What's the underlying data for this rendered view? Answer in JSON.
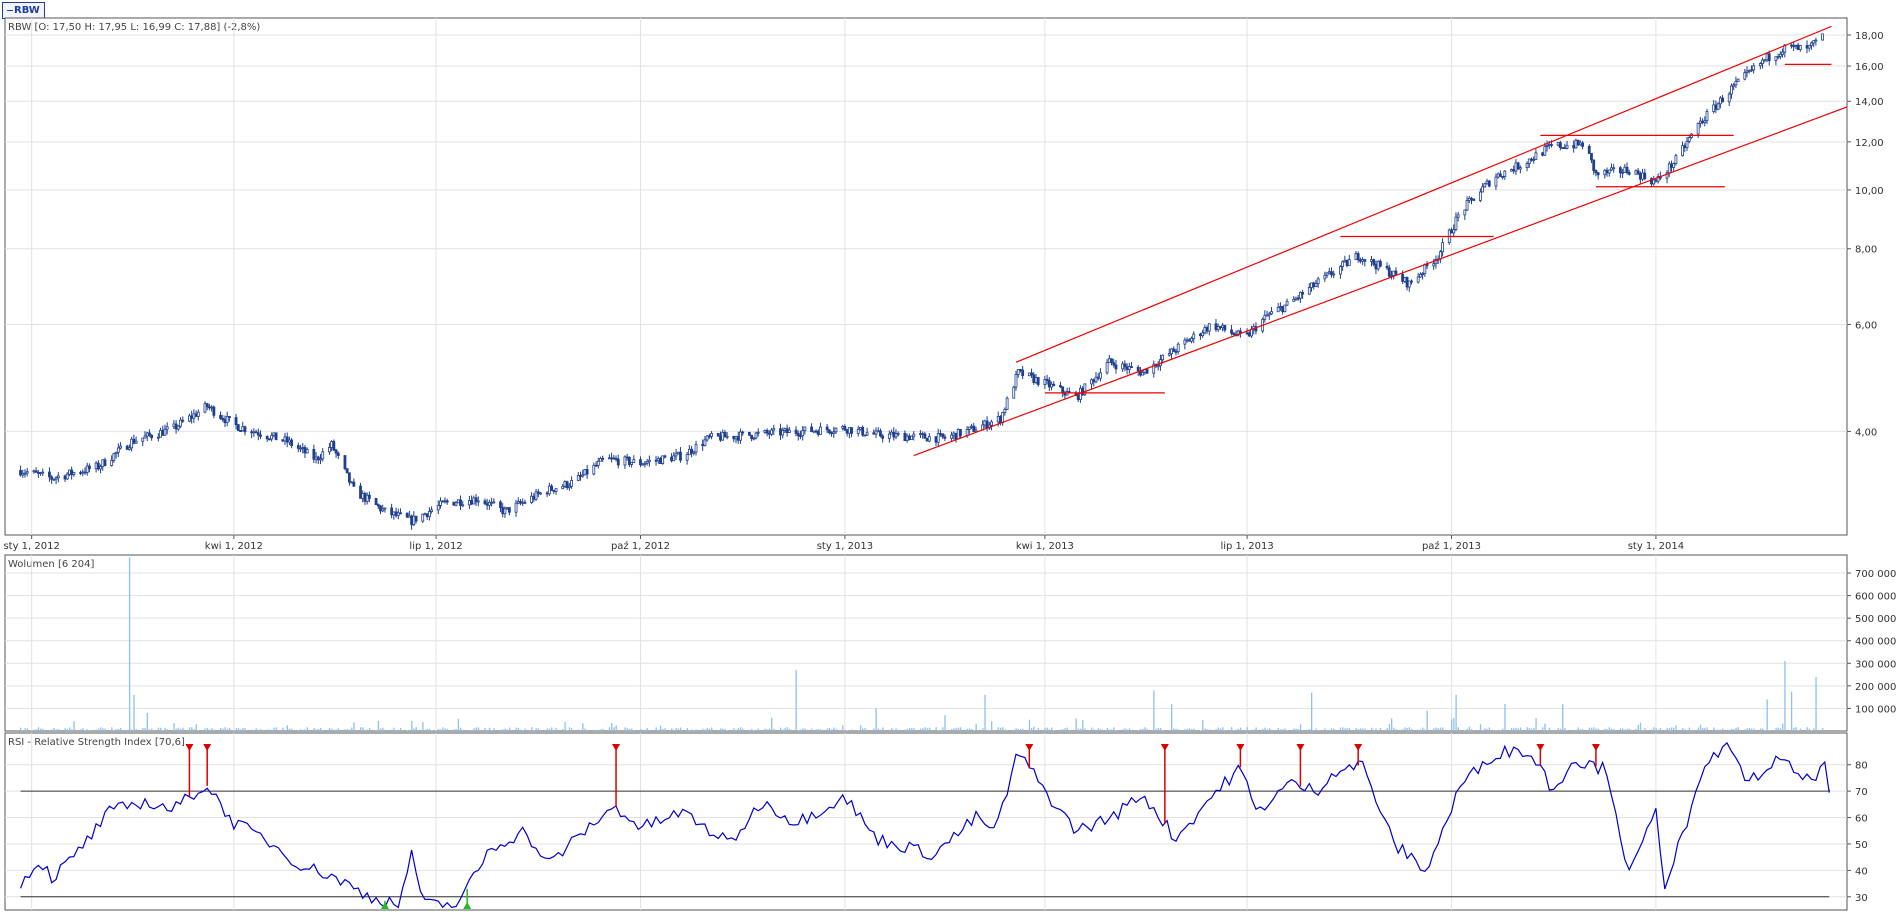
{
  "tab": {
    "label": "RBW"
  },
  "chart_data": [
    {
      "type": "candlestick",
      "title": "RBW [O: 17,50  H: 17,95  L: 16,99  C: 17,88] (-2,8%)",
      "y_scale": "log",
      "ylim": [
        2.7,
        19.2
      ],
      "yticks": [
        4,
        6,
        8,
        10,
        12,
        14,
        16,
        18
      ],
      "ytick_labels": [
        "4,00",
        "6,00",
        "8,00",
        "10,00",
        "12,00",
        "14,00",
        "16,00",
        "18,00"
      ],
      "xlim": [
        "2011-12-20",
        "2014-03-28"
      ],
      "xticks": [
        {
          "date": "2012-01-01",
          "label": "sty 1, 2012"
        },
        {
          "date": "2012-04-01",
          "label": "kwi 1, 2012"
        },
        {
          "date": "2012-07-01",
          "label": "lip 1, 2012"
        },
        {
          "date": "2012-10-01",
          "label": "paź 1, 2012"
        },
        {
          "date": "2013-01-01",
          "label": "sty 1, 2013"
        },
        {
          "date": "2013-04-01",
          "label": "kwi 1, 2013"
        },
        {
          "date": "2013-07-01",
          "label": "lip 1, 2013"
        },
        {
          "date": "2013-10-01",
          "label": "paź 1, 2013"
        },
        {
          "date": "2014-01-01",
          "label": "sty 1, 2014"
        }
      ],
      "close_path": [
        [
          "2011-12-27",
          3.45
        ],
        [
          "2012-01-10",
          3.35
        ],
        [
          "2012-01-31",
          3.5
        ],
        [
          "2012-02-15",
          3.85
        ],
        [
          "2012-03-05",
          4.05
        ],
        [
          "2012-03-20",
          4.4
        ],
        [
          "2012-04-01",
          4.1
        ],
        [
          "2012-04-25",
          3.85
        ],
        [
          "2012-05-08",
          3.6
        ],
        [
          "2012-05-15",
          3.8
        ],
        [
          "2012-05-25",
          3.2
        ],
        [
          "2012-06-08",
          2.95
        ],
        [
          "2012-06-20",
          2.85
        ],
        [
          "2012-07-05",
          3.05
        ],
        [
          "2012-07-20",
          3.1
        ],
        [
          "2012-08-01",
          2.95
        ],
        [
          "2012-08-20",
          3.2
        ],
        [
          "2012-09-01",
          3.3
        ],
        [
          "2012-09-15",
          3.6
        ],
        [
          "2012-10-01",
          3.55
        ],
        [
          "2012-10-20",
          3.65
        ],
        [
          "2012-11-01",
          3.9
        ],
        [
          "2012-11-20",
          3.95
        ],
        [
          "2012-12-10",
          4.0
        ],
        [
          "2013-01-01",
          4.05
        ],
        [
          "2013-01-15",
          3.95
        ],
        [
          "2013-02-15",
          3.9
        ],
        [
          "2013-03-01",
          4.05
        ],
        [
          "2013-03-12",
          4.2
        ],
        [
          "2013-03-20",
          5.0
        ],
        [
          "2013-04-01",
          4.8
        ],
        [
          "2013-04-15",
          4.55
        ],
        [
          "2013-04-30",
          5.2
        ],
        [
          "2013-05-15",
          5.0
        ],
        [
          "2013-05-31",
          5.5
        ],
        [
          "2013-06-15",
          6.0
        ],
        [
          "2013-06-30",
          5.7
        ],
        [
          "2013-07-10",
          6.2
        ],
        [
          "2013-07-20",
          6.5
        ],
        [
          "2013-08-01",
          7.0
        ],
        [
          "2013-08-20",
          7.8
        ],
        [
          "2013-09-01",
          7.4
        ],
        [
          "2013-09-12",
          7.0
        ],
        [
          "2013-09-25",
          7.8
        ],
        [
          "2013-10-05",
          9.2
        ],
        [
          "2013-10-20",
          10.5
        ],
        [
          "2013-11-01",
          11.0
        ],
        [
          "2013-11-15",
          11.8
        ],
        [
          "2013-11-30",
          11.9
        ],
        [
          "2013-12-05",
          10.6
        ],
        [
          "2013-12-20",
          10.8
        ],
        [
          "2014-01-01",
          10.3
        ],
        [
          "2014-01-10",
          11.2
        ],
        [
          "2014-01-20",
          12.8
        ],
        [
          "2014-02-05",
          14.8
        ],
        [
          "2014-02-20",
          16.5
        ],
        [
          "2014-03-01",
          17.2
        ],
        [
          "2014-03-10",
          17.0
        ],
        [
          "2014-03-17",
          17.88
        ]
      ],
      "trendlines": [
        {
          "role": "channel-upper",
          "from": [
            "2013-03-19",
            5.2
          ],
          "to": [
            "2014-03-21",
            18.6
          ]
        },
        {
          "role": "channel-lower",
          "from": [
            "2013-02-01",
            3.65
          ],
          "to": [
            "2014-03-28",
            13.7
          ]
        },
        {
          "role": "support",
          "from": [
            "2013-04-01",
            4.63
          ],
          "to": [
            "2013-05-25",
            4.63
          ]
        },
        {
          "role": "resistance",
          "from": [
            "2013-08-12",
            8.38
          ],
          "to": [
            "2013-10-20",
            8.38
          ]
        },
        {
          "role": "resistance",
          "from": [
            "2013-11-10",
            12.3
          ],
          "to": [
            "2014-02-05",
            12.3
          ]
        },
        {
          "role": "support",
          "from": [
            "2013-12-05",
            10.12
          ],
          "to": [
            "2014-02-01",
            10.12
          ]
        },
        {
          "role": "support",
          "from": [
            "2014-02-28",
            16.1
          ],
          "to": [
            "2014-03-21",
            16.1
          ]
        }
      ],
      "colors": {
        "candles": "#1f3f8f",
        "trendlines": "#ee0000",
        "grid": "#e2e2e2"
      }
    },
    {
      "type": "bar",
      "title": "Wolumen [6 204]",
      "ylim": [
        0,
        780000
      ],
      "yticks": [
        100000,
        200000,
        300000,
        400000,
        500000,
        600000,
        700000
      ],
      "ytick_labels": [
        "100 000",
        "200 000",
        "300 000",
        "400 000",
        "500 000",
        "600 000",
        "700 000"
      ],
      "baseline_volume": 9000,
      "spikes": [
        [
          "2012-02-14",
          770000
        ],
        [
          "2012-02-16",
          160000
        ],
        [
          "2012-02-22",
          80000
        ],
        [
          "2012-03-15",
          30000
        ],
        [
          "2012-04-25",
          25000
        ],
        [
          "2012-06-20",
          45000
        ],
        [
          "2012-06-25",
          40000
        ],
        [
          "2012-09-20",
          25000
        ],
        [
          "2012-12-10",
          270000
        ],
        [
          "2013-01-15",
          100000
        ],
        [
          "2013-02-15",
          70000
        ],
        [
          "2013-03-05",
          160000
        ],
        [
          "2013-03-25",
          50000
        ],
        [
          "2013-05-20",
          180000
        ],
        [
          "2013-05-28",
          120000
        ],
        [
          "2013-07-30",
          170000
        ],
        [
          "2013-08-10",
          120000
        ],
        [
          "2013-09-20",
          90000
        ],
        [
          "2013-10-03",
          160000
        ],
        [
          "2013-10-05",
          130000
        ],
        [
          "2013-10-25",
          120000
        ],
        [
          "2013-11-20",
          120000
        ],
        [
          "2014-02-20",
          140000
        ],
        [
          "2014-02-28",
          310000
        ],
        [
          "2014-03-03",
          175000
        ],
        [
          "2014-03-14",
          240000
        ],
        [
          "2014-03-18",
          50000
        ]
      ],
      "colors": {
        "bars": "#8fc0ef"
      }
    },
    {
      "type": "line",
      "title": "RSI - Relative Strength Index [70,6]",
      "ylim": [
        25,
        92
      ],
      "yticks": [
        30,
        40,
        50,
        60,
        70,
        80
      ],
      "ytick_labels": [
        "30",
        "40",
        "50",
        "60",
        "70",
        "80"
      ],
      "levels": [
        30,
        70
      ],
      "rsi_path": [
        [
          "2011-12-27",
          35
        ],
        [
          "2012-01-05",
          44
        ],
        [
          "2012-01-10",
          37
        ],
        [
          "2012-01-20",
          45
        ],
        [
          "2012-02-05",
          62
        ],
        [
          "2012-02-20",
          66
        ],
        [
          "2012-03-05",
          63
        ],
        [
          "2012-03-15",
          70
        ],
        [
          "2012-03-20",
          72
        ],
        [
          "2012-04-01",
          58
        ],
        [
          "2012-04-15",
          52
        ],
        [
          "2012-05-01",
          42
        ],
        [
          "2012-05-15",
          38
        ],
        [
          "2012-06-01",
          30
        ],
        [
          "2012-06-15",
          27
        ],
        [
          "2012-06-20",
          48
        ],
        [
          "2012-06-25",
          27
        ],
        [
          "2012-07-10",
          27
        ],
        [
          "2012-07-15",
          33
        ],
        [
          "2012-07-25",
          48
        ],
        [
          "2012-08-10",
          55
        ],
        [
          "2012-08-20",
          42
        ],
        [
          "2012-09-10",
          58
        ],
        [
          "2012-09-20",
          64
        ],
        [
          "2012-10-01",
          56
        ],
        [
          "2012-10-20",
          62
        ],
        [
          "2012-11-10",
          50
        ],
        [
          "2012-11-25",
          66
        ],
        [
          "2012-12-10",
          58
        ],
        [
          "2013-01-01",
          68
        ],
        [
          "2013-01-15",
          52
        ],
        [
          "2013-02-10",
          46
        ],
        [
          "2013-03-01",
          60
        ],
        [
          "2013-03-10",
          55
        ],
        [
          "2013-03-20",
          85
        ],
        [
          "2013-04-01",
          70
        ],
        [
          "2013-04-15",
          55
        ],
        [
          "2013-05-01",
          60
        ],
        [
          "2013-05-15",
          69
        ],
        [
          "2013-05-30",
          52
        ],
        [
          "2013-06-15",
          68
        ],
        [
          "2013-06-28",
          79
        ],
        [
          "2013-07-05",
          62
        ],
        [
          "2013-07-20",
          73
        ],
        [
          "2013-08-01",
          70
        ],
        [
          "2013-08-10",
          78
        ],
        [
          "2013-08-22",
          80
        ],
        [
          "2013-09-05",
          50
        ],
        [
          "2013-09-20",
          40
        ],
        [
          "2013-10-05",
          72
        ],
        [
          "2013-10-20",
          84
        ],
        [
          "2013-11-01",
          86
        ],
        [
          "2013-11-10",
          80
        ],
        [
          "2013-11-15",
          70
        ],
        [
          "2013-11-25",
          82
        ],
        [
          "2013-12-10",
          78
        ],
        [
          "2013-12-20",
          38
        ],
        [
          "2014-01-01",
          62
        ],
        [
          "2014-01-05",
          35
        ],
        [
          "2014-01-15",
          58
        ],
        [
          "2014-01-25",
          82
        ],
        [
          "2014-02-05",
          88
        ],
        [
          "2014-02-10",
          72
        ],
        [
          "2014-02-25",
          82
        ],
        [
          "2014-03-10",
          74
        ],
        [
          "2014-03-18",
          79
        ],
        [
          "2014-03-20",
          70.6
        ]
      ],
      "sell_markers": [
        "2012-03-12",
        "2012-03-20",
        "2012-09-20",
        "2013-03-25",
        "2013-05-25",
        "2013-06-28",
        "2013-07-25",
        "2013-08-20",
        "2013-11-10",
        "2013-12-05"
      ],
      "buy_markers": [
        "2012-06-08",
        "2012-07-15"
      ],
      "colors": {
        "line": "#0000d0",
        "levels": "#333333",
        "sell": "#dd0000",
        "buy": "#22bb22"
      }
    }
  ]
}
